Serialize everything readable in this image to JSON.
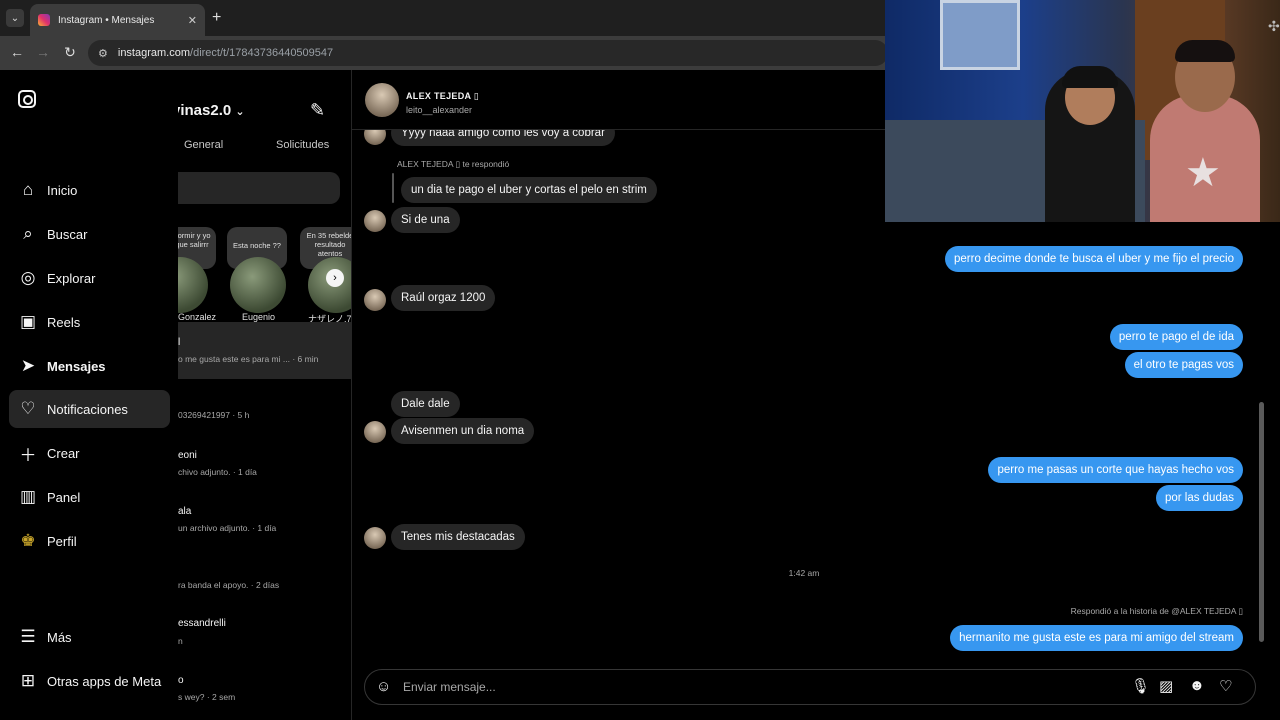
{
  "browser": {
    "tab_title": "Instagram • Mensajes",
    "url_host": "instagram.com",
    "url_path": "/direct/t/17843736440509547"
  },
  "nav": {
    "items": [
      {
        "label": "Inicio",
        "icon": "home-icon"
      },
      {
        "label": "Buscar",
        "icon": "search-icon"
      },
      {
        "label": "Explorar",
        "icon": "compass-icon"
      },
      {
        "label": "Reels",
        "icon": "reels-icon"
      },
      {
        "label": "Mensajes",
        "icon": "messenger-icon"
      },
      {
        "label": "Notificaciones",
        "icon": "heart-icon"
      },
      {
        "label": "Crear",
        "icon": "plus-icon"
      },
      {
        "label": "Panel",
        "icon": "chart-icon"
      },
      {
        "label": "Perfil",
        "icon": "profile-icon"
      },
      {
        "label": "Más",
        "icon": "menu-icon"
      },
      {
        "label": "Otras apps de Meta",
        "icon": "meta-apps-icon"
      }
    ]
  },
  "inbox": {
    "title": "vinas2.0",
    "tabs": [
      "General",
      "Solicitudes"
    ],
    "notes": [
      {
        "text": "dormir y yo que salirrr",
        "name": "Gonzalez"
      },
      {
        "text": "Esta noche ??",
        "name": "Eugenio"
      },
      {
        "text": "En 35 rebelde resultado atentos",
        "name": "ナザレノ.7."
      }
    ],
    "conversations": [
      {
        "name": "l",
        "preview": "o me gusta este es para mi ... · 6 min"
      },
      {
        "name": "",
        "preview": "03269421997 · 5 h"
      },
      {
        "name": "eoni",
        "preview": "chivo adjunto. · 1 día"
      },
      {
        "name": "ala",
        "preview": "un archivo adjunto. · 1 día"
      },
      {
        "name": "",
        "preview": "ra banda el apoyo. · 2 días"
      },
      {
        "name": "essandrelli",
        "preview": "n"
      },
      {
        "name": "o",
        "preview": "s wey? · 2 sem"
      }
    ]
  },
  "chat": {
    "contact_name": "ALEX TEJEDA ▯",
    "contact_username": "leito__alexander",
    "messages_in": [
      "Yyyy naaa amigo como les voy a cobrar",
      "un dia te pago el uber y cortas el pelo en strim",
      "Si de una",
      "Raúl orgaz 1200",
      "Dale dale",
      "Avisenmen un dia noma",
      "Tenes mis destacadas"
    ],
    "messages_out": [
      "perro decime donde te busca el uber y me fijo el precio",
      "perro te pago el de ida",
      "el otro te pagas vos",
      "perro me pasas un corte que hayas hecho vos",
      "por las dudas",
      "hermanito me gusta este es para mi amigo del stream"
    ],
    "reply_meta": "ALEX TEJEDA ▯ te respondió",
    "timestamp": "1:42 am",
    "story_reply_meta": "Respondió a la historia de @ALEX TEJEDA ▯",
    "composer_placeholder": "Enviar mensaje..."
  },
  "colors": {
    "outgoing_bubble": "#3797f0",
    "incoming_bubble": "#262626",
    "background": "#000000"
  }
}
